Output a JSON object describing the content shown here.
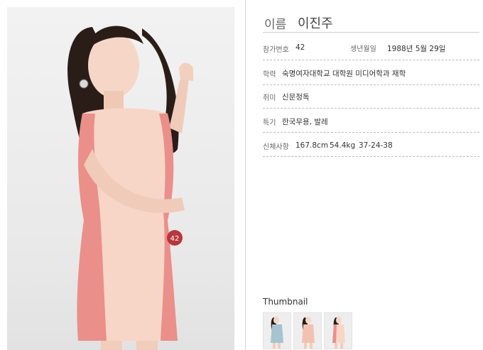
{
  "profile": {
    "name_label": "이름",
    "name_value": "이진주",
    "fields": {
      "entry_number": {
        "label": "참가번호",
        "value": "42"
      },
      "birth_date": {
        "label": "생년월일",
        "value": "1988년 5월 29일"
      },
      "education": {
        "label": "학력",
        "value": "숙명여자대학교 대학원 미디어학과 재학"
      },
      "hobby": {
        "label": "취미",
        "value": "신문정독"
      },
      "specialty": {
        "label": "특기",
        "value": "한국무용, 발레"
      },
      "body": {
        "label": "신체사항",
        "height": "167.8cm",
        "weight": "54.4kg",
        "measurements": "37-24-38"
      }
    }
  },
  "contestant_badge": "42",
  "thumbnails": {
    "title": "Thumbnail",
    "items": [
      "thumbnail-1",
      "thumbnail-2",
      "thumbnail-3"
    ]
  },
  "colors": {
    "dress_light": "#f7d6c7",
    "dress_pink": "#ea8f8a",
    "hair": "#2a1d18",
    "skin": "#f6d7c7",
    "badge": "#b7373c"
  }
}
